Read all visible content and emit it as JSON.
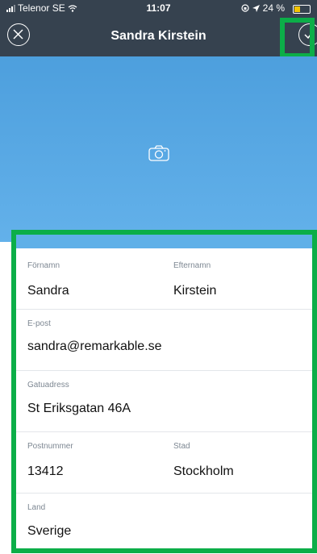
{
  "status_bar": {
    "carrier": "Telenor SE",
    "time": "11:07",
    "battery_text": "24 %"
  },
  "nav": {
    "title": "Sandra Kirstein"
  },
  "form": {
    "first_name": {
      "label": "Förnamn",
      "value": "Sandra"
    },
    "last_name": {
      "label": "Efternamn",
      "value": "Kirstein"
    },
    "email": {
      "label": "E-post",
      "value": "sandra@remarkable.se"
    },
    "street": {
      "label": "Gatuadress",
      "value": "St Eriksgatan 46A"
    },
    "postal": {
      "label": "Postnummer",
      "value": "13412"
    },
    "city": {
      "label": "Stad",
      "value": "Stockholm"
    },
    "country": {
      "label": "Land",
      "value": "Sverige"
    }
  },
  "colors": {
    "nav_bg": "#36424f",
    "photo_bg": "#5aa9e6",
    "highlight": "#0cae48"
  }
}
